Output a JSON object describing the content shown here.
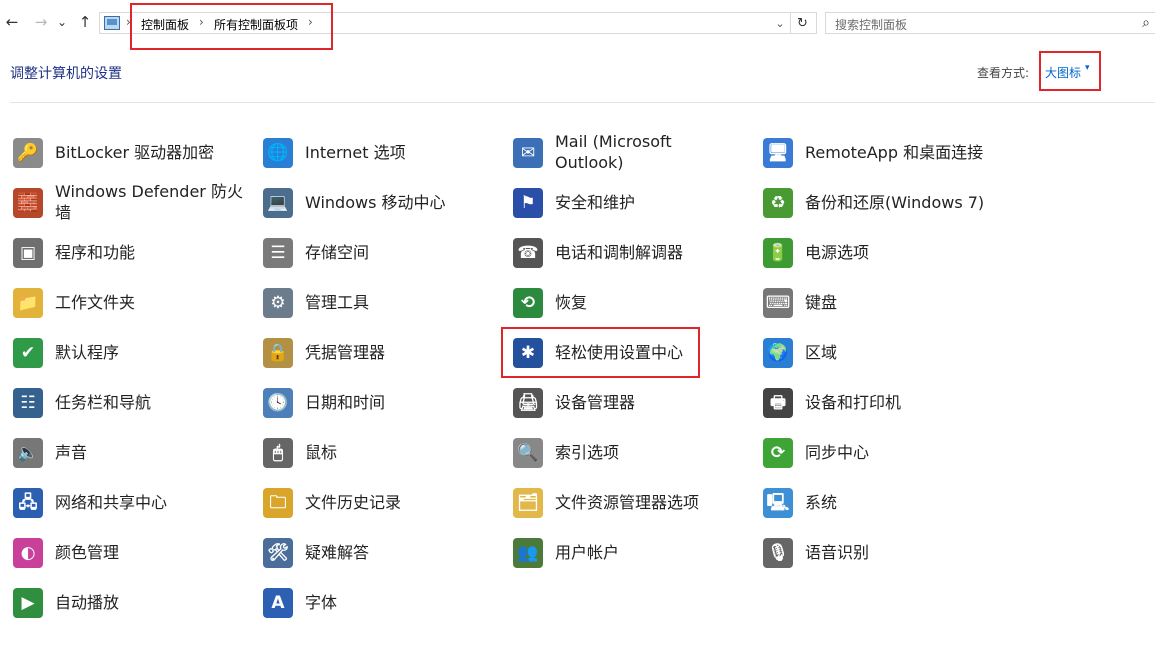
{
  "nav": {
    "back_glyph": "←",
    "forward_glyph": "→",
    "recent_glyph": "⌄",
    "up_glyph": "↑",
    "breadcrumb": [
      "控制面板",
      "所有控制面板项"
    ],
    "dropdown_glyph": "⌄",
    "refresh_glyph": "↻",
    "search_placeholder": "搜索控制面板",
    "search_glyph": "⌕"
  },
  "header": {
    "title": "调整计算机的设置",
    "view_label": "查看方式:",
    "view_value": "大图标",
    "view_caret": "▾"
  },
  "items": [
    {
      "label": "BitLocker 驱动器加密",
      "icon": "bitlocker-icon",
      "glyph": "🔑",
      "color": "#8a8a8a"
    },
    {
      "label": "Internet 选项",
      "icon": "internet-options-icon",
      "glyph": "🌐",
      "color": "#2a7fd4"
    },
    {
      "label": "Mail (Microsoft Outlook)",
      "icon": "mail-icon",
      "glyph": "✉",
      "color": "#3b6fb6"
    },
    {
      "label": "RemoteApp 和桌面连接",
      "icon": "remoteapp-icon",
      "glyph": "🖥",
      "color": "#3a7bd5"
    },
    {
      "label": "Windows Defender 防火墙",
      "icon": "firewall-icon",
      "glyph": "🧱",
      "color": "#b5472a"
    },
    {
      "label": "Windows 移动中心",
      "icon": "mobility-center-icon",
      "glyph": "💻",
      "color": "#4d6d8f"
    },
    {
      "label": "安全和维护",
      "icon": "security-flag-icon",
      "glyph": "⚑",
      "color": "#2a4fa8"
    },
    {
      "label": "备份和还原(Windows 7)",
      "icon": "backup-icon",
      "glyph": "♻",
      "color": "#4a9a34"
    },
    {
      "label": "程序和功能",
      "icon": "programs-icon",
      "glyph": "▣",
      "color": "#6f6f6f"
    },
    {
      "label": "存储空间",
      "icon": "storage-icon",
      "glyph": "☰",
      "color": "#7a7a7a"
    },
    {
      "label": "电话和调制解调器",
      "icon": "phone-modem-icon",
      "glyph": "☎",
      "color": "#555555"
    },
    {
      "label": "电源选项",
      "icon": "power-icon",
      "glyph": "🔋",
      "color": "#3e9a33"
    },
    {
      "label": "工作文件夹",
      "icon": "work-folders-icon",
      "glyph": "📁",
      "color": "#e2b33a"
    },
    {
      "label": "管理工具",
      "icon": "admin-tools-icon",
      "glyph": "⚙",
      "color": "#6b7c8d"
    },
    {
      "label": "恢复",
      "icon": "recovery-icon",
      "glyph": "⟲",
      "color": "#2b8a3e"
    },
    {
      "label": "键盘",
      "icon": "keyboard-icon",
      "glyph": "⌨",
      "color": "#777777"
    },
    {
      "label": "默认程序",
      "icon": "default-programs-icon",
      "glyph": "✔",
      "color": "#2f9a48"
    },
    {
      "label": "凭据管理器",
      "icon": "credential-manager-icon",
      "glyph": "🔒",
      "color": "#b39144"
    },
    {
      "label": "轻松使用设置中心",
      "icon": "ease-of-access-icon",
      "glyph": "✱",
      "color": "#24519d"
    },
    {
      "label": "区域",
      "icon": "region-icon",
      "glyph": "🌍",
      "color": "#2a7fd4"
    },
    {
      "label": "任务栏和导航",
      "icon": "taskbar-icon",
      "glyph": "☷",
      "color": "#34618e"
    },
    {
      "label": "日期和时间",
      "icon": "date-time-icon",
      "glyph": "🕓",
      "color": "#4e7fb8"
    },
    {
      "label": "设备管理器",
      "icon": "device-manager-icon",
      "glyph": "🖨",
      "color": "#555555"
    },
    {
      "label": "设备和打印机",
      "icon": "devices-printers-icon",
      "glyph": "🖶",
      "color": "#444444"
    },
    {
      "label": "声音",
      "icon": "sound-icon",
      "glyph": "🔈",
      "color": "#777777"
    },
    {
      "label": "鼠标",
      "icon": "mouse-icon",
      "glyph": "🖱",
      "color": "#666666"
    },
    {
      "label": "索引选项",
      "icon": "indexing-icon",
      "glyph": "🔍",
      "color": "#888888"
    },
    {
      "label": "同步中心",
      "icon": "sync-center-icon",
      "glyph": "⟳",
      "color": "#3fa436"
    },
    {
      "label": "网络和共享中心",
      "icon": "network-icon",
      "glyph": "🖧",
      "color": "#2b5fb0"
    },
    {
      "label": "文件历史记录",
      "icon": "file-history-icon",
      "glyph": "🗀",
      "color": "#d9a52b"
    },
    {
      "label": "文件资源管理器选项",
      "icon": "explorer-options-icon",
      "glyph": "🗂",
      "color": "#e3b84a"
    },
    {
      "label": "系统",
      "icon": "system-icon",
      "glyph": "🖳",
      "color": "#3d8fd6"
    },
    {
      "label": "颜色管理",
      "icon": "color-management-icon",
      "glyph": "◐",
      "color": "#c9409a"
    },
    {
      "label": "疑难解答",
      "icon": "troubleshooting-icon",
      "glyph": "🛠",
      "color": "#4a6d9a"
    },
    {
      "label": "用户帐户",
      "icon": "user-accounts-icon",
      "glyph": "👥",
      "color": "#4c7a3a"
    },
    {
      "label": "语音识别",
      "icon": "speech-recognition-icon",
      "glyph": "🎙",
      "color": "#666666"
    },
    {
      "label": "自动播放",
      "icon": "autoplay-icon",
      "glyph": "▶",
      "color": "#2f8f3f"
    },
    {
      "label": "字体",
      "icon": "fonts-icon",
      "glyph": "A",
      "color": "#2d5fb3"
    }
  ]
}
